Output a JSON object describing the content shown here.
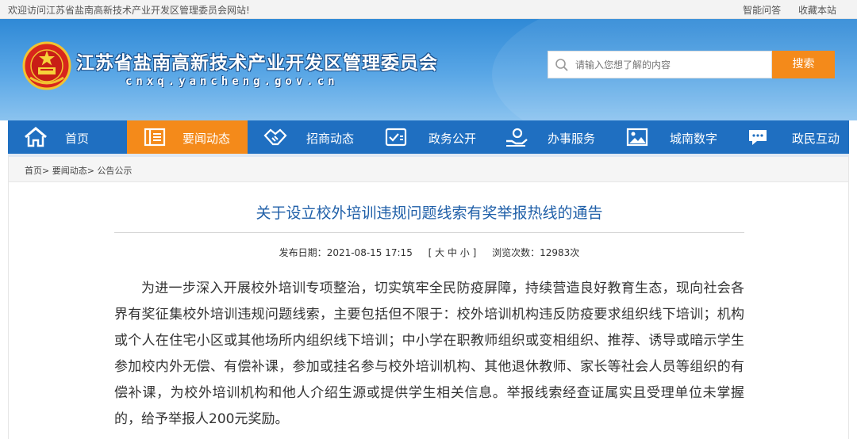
{
  "topbar": {
    "welcome": "欢迎访问江苏省盐南高新技术产业开发区管理委员会网站!",
    "links": [
      "智能问答",
      "收藏本站"
    ]
  },
  "header": {
    "title": "江苏省盐南高新技术产业开发区管理委员会",
    "domain": "cnxq.yancheng.gov.cn"
  },
  "search": {
    "placeholder": "请输入您想了解的内容",
    "button": "搜索"
  },
  "nav": {
    "items": [
      {
        "label": "首页",
        "icon": "home-icon"
      },
      {
        "label": "要闻动态",
        "icon": "news-icon",
        "active": true
      },
      {
        "label": "招商动态",
        "icon": "handshake-icon"
      },
      {
        "label": "政务公开",
        "icon": "document-check-icon"
      },
      {
        "label": "办事服务",
        "icon": "service-hand-icon"
      },
      {
        "label": "城南数字",
        "icon": "picture-icon"
      },
      {
        "label": "政民互动",
        "icon": "chat-bubble-icon"
      }
    ]
  },
  "breadcrumb": {
    "items": [
      "首页",
      "要闻动态",
      "公告公示"
    ],
    "separator": ">"
  },
  "article": {
    "title": "关于设立校外培训违规问题线索有奖举报热线的通告",
    "meta_date_label": "发布日期：",
    "meta_date": "2021-08-15 17:15",
    "font_size_control": "[ 大 中 小 ]",
    "views_label": "浏览次数：",
    "views": "12983次",
    "body": "为进一步深入开展校外培训专项整治，切实筑牢全民防疫屏障，持续营造良好教育生态，现向社会各界有奖征集校外培训违规问题线索，主要包括但不限于：校外培训机构违反防疫要求组织线下培训；机构或个人在住宅小区或其他场所内组织线下培训；中小学在职教师组织或变相组织、推荐、诱导或暗示学生参加校内外无偿、有偿补课，参加或挂名参与校外培训机构、其他退休教师、家长等社会人员等组织的有偿补课，为校外培训机构和他人介绍生源或提供学生相关信息。举报线索经查证属实且受理单位未掌握的，给予举报人200元奖励。"
  },
  "colors": {
    "nav_blue": "#1f6fc1",
    "accent_orange": "#f48a1a",
    "title_blue": "#1f5fa8"
  }
}
